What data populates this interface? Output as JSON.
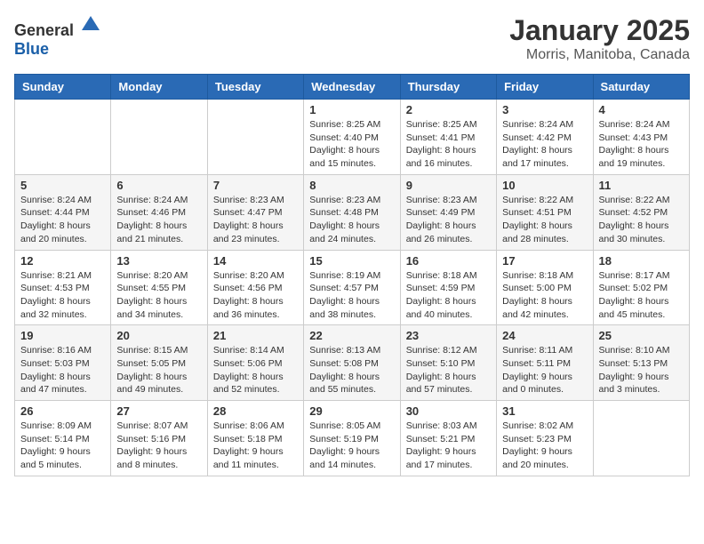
{
  "logo": {
    "general": "General",
    "blue": "Blue"
  },
  "title": {
    "month": "January 2025",
    "location": "Morris, Manitoba, Canada"
  },
  "days_of_week": [
    "Sunday",
    "Monday",
    "Tuesday",
    "Wednesday",
    "Thursday",
    "Friday",
    "Saturday"
  ],
  "weeks": [
    [
      {
        "day": "",
        "sunrise": "",
        "sunset": "",
        "daylight": ""
      },
      {
        "day": "",
        "sunrise": "",
        "sunset": "",
        "daylight": ""
      },
      {
        "day": "",
        "sunrise": "",
        "sunset": "",
        "daylight": ""
      },
      {
        "day": "1",
        "sunrise": "Sunrise: 8:25 AM",
        "sunset": "Sunset: 4:40 PM",
        "daylight": "Daylight: 8 hours and 15 minutes."
      },
      {
        "day": "2",
        "sunrise": "Sunrise: 8:25 AM",
        "sunset": "Sunset: 4:41 PM",
        "daylight": "Daylight: 8 hours and 16 minutes."
      },
      {
        "day": "3",
        "sunrise": "Sunrise: 8:24 AM",
        "sunset": "Sunset: 4:42 PM",
        "daylight": "Daylight: 8 hours and 17 minutes."
      },
      {
        "day": "4",
        "sunrise": "Sunrise: 8:24 AM",
        "sunset": "Sunset: 4:43 PM",
        "daylight": "Daylight: 8 hours and 19 minutes."
      }
    ],
    [
      {
        "day": "5",
        "sunrise": "Sunrise: 8:24 AM",
        "sunset": "Sunset: 4:44 PM",
        "daylight": "Daylight: 8 hours and 20 minutes."
      },
      {
        "day": "6",
        "sunrise": "Sunrise: 8:24 AM",
        "sunset": "Sunset: 4:46 PM",
        "daylight": "Daylight: 8 hours and 21 minutes."
      },
      {
        "day": "7",
        "sunrise": "Sunrise: 8:23 AM",
        "sunset": "Sunset: 4:47 PM",
        "daylight": "Daylight: 8 hours and 23 minutes."
      },
      {
        "day": "8",
        "sunrise": "Sunrise: 8:23 AM",
        "sunset": "Sunset: 4:48 PM",
        "daylight": "Daylight: 8 hours and 24 minutes."
      },
      {
        "day": "9",
        "sunrise": "Sunrise: 8:23 AM",
        "sunset": "Sunset: 4:49 PM",
        "daylight": "Daylight: 8 hours and 26 minutes."
      },
      {
        "day": "10",
        "sunrise": "Sunrise: 8:22 AM",
        "sunset": "Sunset: 4:51 PM",
        "daylight": "Daylight: 8 hours and 28 minutes."
      },
      {
        "day": "11",
        "sunrise": "Sunrise: 8:22 AM",
        "sunset": "Sunset: 4:52 PM",
        "daylight": "Daylight: 8 hours and 30 minutes."
      }
    ],
    [
      {
        "day": "12",
        "sunrise": "Sunrise: 8:21 AM",
        "sunset": "Sunset: 4:53 PM",
        "daylight": "Daylight: 8 hours and 32 minutes."
      },
      {
        "day": "13",
        "sunrise": "Sunrise: 8:20 AM",
        "sunset": "Sunset: 4:55 PM",
        "daylight": "Daylight: 8 hours and 34 minutes."
      },
      {
        "day": "14",
        "sunrise": "Sunrise: 8:20 AM",
        "sunset": "Sunset: 4:56 PM",
        "daylight": "Daylight: 8 hours and 36 minutes."
      },
      {
        "day": "15",
        "sunrise": "Sunrise: 8:19 AM",
        "sunset": "Sunset: 4:57 PM",
        "daylight": "Daylight: 8 hours and 38 minutes."
      },
      {
        "day": "16",
        "sunrise": "Sunrise: 8:18 AM",
        "sunset": "Sunset: 4:59 PM",
        "daylight": "Daylight: 8 hours and 40 minutes."
      },
      {
        "day": "17",
        "sunrise": "Sunrise: 8:18 AM",
        "sunset": "Sunset: 5:00 PM",
        "daylight": "Daylight: 8 hours and 42 minutes."
      },
      {
        "day": "18",
        "sunrise": "Sunrise: 8:17 AM",
        "sunset": "Sunset: 5:02 PM",
        "daylight": "Daylight: 8 hours and 45 minutes."
      }
    ],
    [
      {
        "day": "19",
        "sunrise": "Sunrise: 8:16 AM",
        "sunset": "Sunset: 5:03 PM",
        "daylight": "Daylight: 8 hours and 47 minutes."
      },
      {
        "day": "20",
        "sunrise": "Sunrise: 8:15 AM",
        "sunset": "Sunset: 5:05 PM",
        "daylight": "Daylight: 8 hours and 49 minutes."
      },
      {
        "day": "21",
        "sunrise": "Sunrise: 8:14 AM",
        "sunset": "Sunset: 5:06 PM",
        "daylight": "Daylight: 8 hours and 52 minutes."
      },
      {
        "day": "22",
        "sunrise": "Sunrise: 8:13 AM",
        "sunset": "Sunset: 5:08 PM",
        "daylight": "Daylight: 8 hours and 55 minutes."
      },
      {
        "day": "23",
        "sunrise": "Sunrise: 8:12 AM",
        "sunset": "Sunset: 5:10 PM",
        "daylight": "Daylight: 8 hours and 57 minutes."
      },
      {
        "day": "24",
        "sunrise": "Sunrise: 8:11 AM",
        "sunset": "Sunset: 5:11 PM",
        "daylight": "Daylight: 9 hours and 0 minutes."
      },
      {
        "day": "25",
        "sunrise": "Sunrise: 8:10 AM",
        "sunset": "Sunset: 5:13 PM",
        "daylight": "Daylight: 9 hours and 3 minutes."
      }
    ],
    [
      {
        "day": "26",
        "sunrise": "Sunrise: 8:09 AM",
        "sunset": "Sunset: 5:14 PM",
        "daylight": "Daylight: 9 hours and 5 minutes."
      },
      {
        "day": "27",
        "sunrise": "Sunrise: 8:07 AM",
        "sunset": "Sunset: 5:16 PM",
        "daylight": "Daylight: 9 hours and 8 minutes."
      },
      {
        "day": "28",
        "sunrise": "Sunrise: 8:06 AM",
        "sunset": "Sunset: 5:18 PM",
        "daylight": "Daylight: 9 hours and 11 minutes."
      },
      {
        "day": "29",
        "sunrise": "Sunrise: 8:05 AM",
        "sunset": "Sunset: 5:19 PM",
        "daylight": "Daylight: 9 hours and 14 minutes."
      },
      {
        "day": "30",
        "sunrise": "Sunrise: 8:03 AM",
        "sunset": "Sunset: 5:21 PM",
        "daylight": "Daylight: 9 hours and 17 minutes."
      },
      {
        "day": "31",
        "sunrise": "Sunrise: 8:02 AM",
        "sunset": "Sunset: 5:23 PM",
        "daylight": "Daylight: 9 hours and 20 minutes."
      },
      {
        "day": "",
        "sunrise": "",
        "sunset": "",
        "daylight": ""
      }
    ]
  ]
}
